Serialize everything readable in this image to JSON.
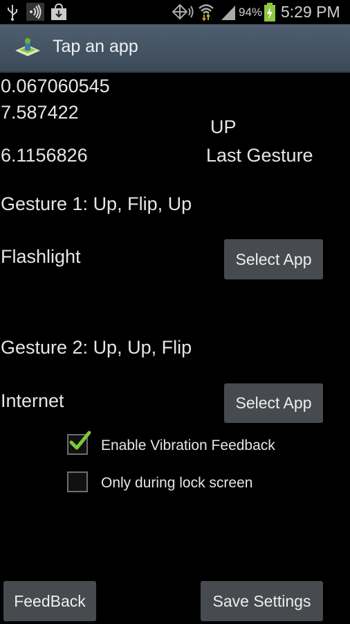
{
  "status_bar": {
    "icons": [
      "usb-icon",
      "nfc-icon",
      "download-icon",
      "gps-icon",
      "wifi-icon",
      "signal-icon",
      "battery-charging-icon"
    ],
    "battery_percent": "94%",
    "time": "5:29 PM",
    "battery_color": "#8dc63f"
  },
  "action_bar": {
    "title": "Tap an app",
    "icon": "app-launcher-icon"
  },
  "sensor": {
    "x": "0.067060545",
    "y": "7.587422",
    "z": "6.1156826"
  },
  "last_gesture": {
    "value": "UP",
    "label": "Last Gesture"
  },
  "gestures": [
    {
      "label": "Gesture 1: Up, Flip, Up",
      "app": "Flashlight",
      "button": "Select App"
    },
    {
      "label": "Gesture 2: Up, Up, Flip",
      "app": "Internet",
      "button": "Select App"
    }
  ],
  "options": [
    {
      "label": "Enable Vibration Feedback",
      "checked": true
    },
    {
      "label": "Only during lock screen",
      "checked": false
    }
  ],
  "footer": {
    "feedback": "FeedBack",
    "save": "Save Settings"
  },
  "colors": {
    "check": "#7ec83a",
    "button_bg": "#474a4e",
    "actionbar": "#46555f"
  }
}
